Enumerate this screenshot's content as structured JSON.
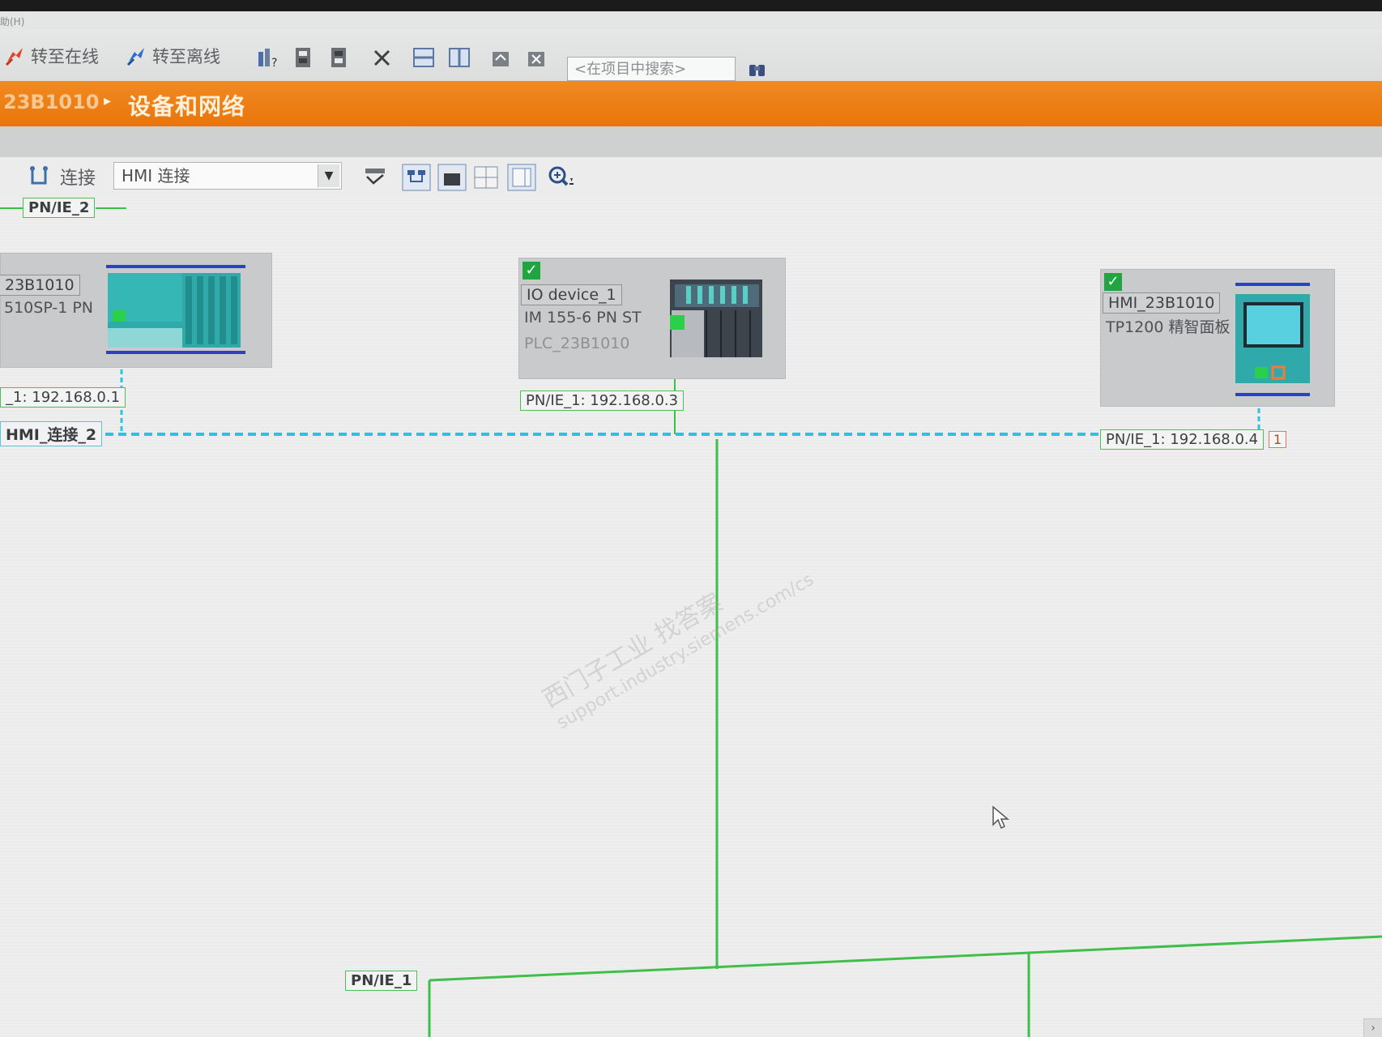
{
  "menu": {
    "fragment": "助(H)"
  },
  "toolbar": {
    "go_online": "转至在线",
    "go_offline": "转至离线",
    "search_placeholder": "<在项目中搜索>"
  },
  "breadcrumb": {
    "project": "23B1010",
    "current": "设备和网络"
  },
  "network_toolbar": {
    "connections_label": "连接",
    "connection_type": "HMI 连接"
  },
  "subnets": {
    "top": "PN/IE_2",
    "bottom": "PN/IE_1"
  },
  "devices": {
    "plc": {
      "name": "23B1010",
      "type": "510SP-1 PN",
      "ip": "_1: 192.168.0.1",
      "connection": "HMI_连接_2"
    },
    "io_device": {
      "name": "IO device_1",
      "type": "IM 155-6 PN ST",
      "controller": "PLC_23B1010",
      "ip": "PN/IE_1: 192.168.0.3"
    },
    "hmi": {
      "name": "HMI_23B1010",
      "type": "TP1200 精智面板",
      "ip": "PN/IE_1: 192.168.0.4",
      "port": "1"
    }
  },
  "watermark": {
    "line1": "西门子工业 找答案",
    "line2": "support.industry.siemens.com/cs"
  },
  "colors": {
    "accent_orange": "#ee7f16",
    "subnet_green": "#3fbf4a",
    "hmi_connection_cyan": "#2bc4dc",
    "module_teal": "#2fa9a9"
  }
}
